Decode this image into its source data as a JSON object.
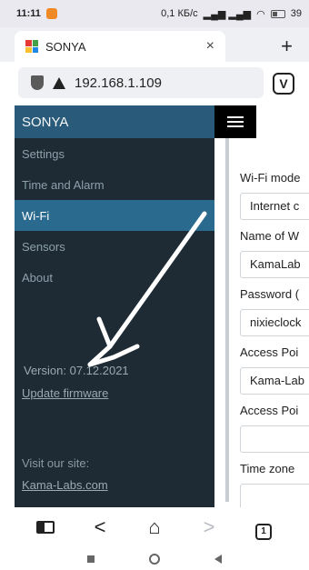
{
  "status_bar": {
    "time": "11:11",
    "network_speed": "0,1 КБ/с",
    "battery": "39"
  },
  "browser": {
    "tab_title": "SONYA",
    "tab_close": "×",
    "new_tab": "+",
    "url": "192.168.1.109",
    "vivaldi_icon": "V"
  },
  "sidebar": {
    "brand": "SONYA",
    "items": [
      {
        "label": "Settings"
      },
      {
        "label": "Time and Alarm"
      },
      {
        "label": "Wi-Fi"
      },
      {
        "label": "Sensors"
      },
      {
        "label": "About"
      }
    ],
    "version": "Version: 07.12.2021",
    "update_link": "Update firmware",
    "visit_label": "Visit our site:",
    "site_link": "Kama-Labs.com"
  },
  "form": {
    "wifi_mode_label": "Wi-Fi mode",
    "wifi_mode_value": "Internet c",
    "wifi_name_label": "Name of W",
    "wifi_name_value": "KamaLab",
    "password_label": "Password (",
    "password_value": "nixieclock",
    "ap_name_label": "Access Poi",
    "ap_name_value": "Kama-Lab",
    "ap_password_label": "Access Poi",
    "ap_password_value": "",
    "timezone_label": "Time zone"
  },
  "toolbar": {
    "back": "<",
    "home": "⌂",
    "forward": ">",
    "tab_count": "1"
  },
  "colors": {
    "sidebar_bg": "#1e2b35",
    "brand_bg": "#2a5a7a",
    "active_bg": "#2a6a8e",
    "arrow": "#ffffff"
  }
}
